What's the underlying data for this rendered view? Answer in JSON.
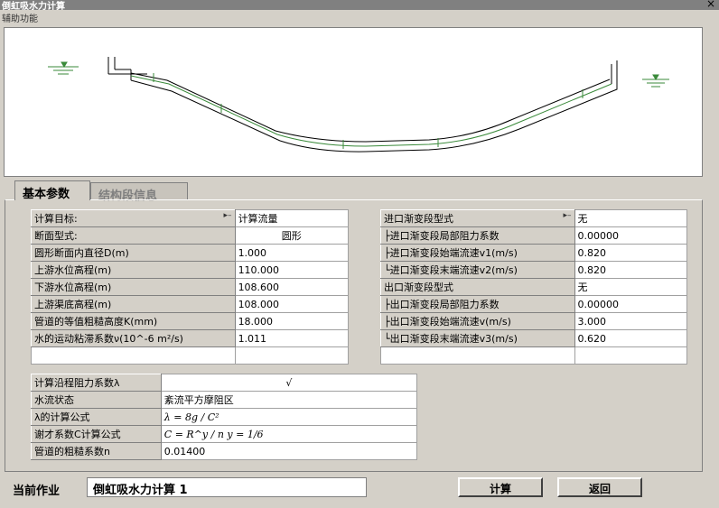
{
  "window": {
    "title": "倒虹吸水力计算",
    "close_label": "×"
  },
  "menu": {
    "label": "辅助功能"
  },
  "tabs": [
    {
      "label": "基本参数"
    },
    {
      "label": "结构段信息"
    }
  ],
  "left_table": [
    {
      "label": "计算目标:",
      "value": "计算流量",
      "has_dropdown": true
    },
    {
      "label": "断面型式:",
      "value": "圆形",
      "centered": true
    },
    {
      "label": "圆形断面内直径D(m)",
      "value": "1.000"
    },
    {
      "label": "上游水位高程(m)",
      "value": "110.000"
    },
    {
      "label": "下游水位高程(m)",
      "value": "108.600"
    },
    {
      "label": "上游渠底高程(m)",
      "value": "108.000"
    },
    {
      "label": "管道的等值粗糙高度K(mm)",
      "value": "18.000"
    },
    {
      "label": "水的运动粘滞系数ν(10^-6 m²/s)",
      "value": "1.011"
    }
  ],
  "right_table": [
    {
      "label": "进口渐变段型式",
      "value": "无",
      "has_dropdown": true
    },
    {
      "label": "├进口渐变段局部阻力系数",
      "value": "0.00000"
    },
    {
      "label": "├进口渐变段始端流速v1(m/s)",
      "value": "0.820"
    },
    {
      "label": "└进口渐变段末端流速v2(m/s)",
      "value": "0.820"
    },
    {
      "label": "出口渐变段型式",
      "value": "无"
    },
    {
      "label": "├出口渐变段局部阻力系数",
      "value": "0.00000"
    },
    {
      "label": "├出口渐变段始端流速v(m/s)",
      "value": "3.000"
    },
    {
      "label": "└出口渐变段末端流速v3(m/s)",
      "value": "0.620"
    }
  ],
  "bottom_table": [
    {
      "label": "计算沿程阻力系数λ",
      "value": "√",
      "centered": true
    },
    {
      "label": "水流状态",
      "value": "紊流平方摩阻区"
    },
    {
      "label": "λ的计算公式",
      "value": "λ = 8g / C²",
      "formula": true
    },
    {
      "label": "谢才系数C计算公式",
      "value": "C = R^y / n    y = 1/6",
      "formula": true
    },
    {
      "label": "管道的粗糙系数n",
      "value": "0.01400"
    }
  ],
  "footer": {
    "current_job_label": "当前作业",
    "current_job_value": "倒虹吸水力计算 1",
    "calc_button": "计算",
    "back_button": "返回"
  },
  "colors": {
    "pipe": "#3a8a3a",
    "ground": "#000000",
    "water": "#3a8a3a"
  }
}
